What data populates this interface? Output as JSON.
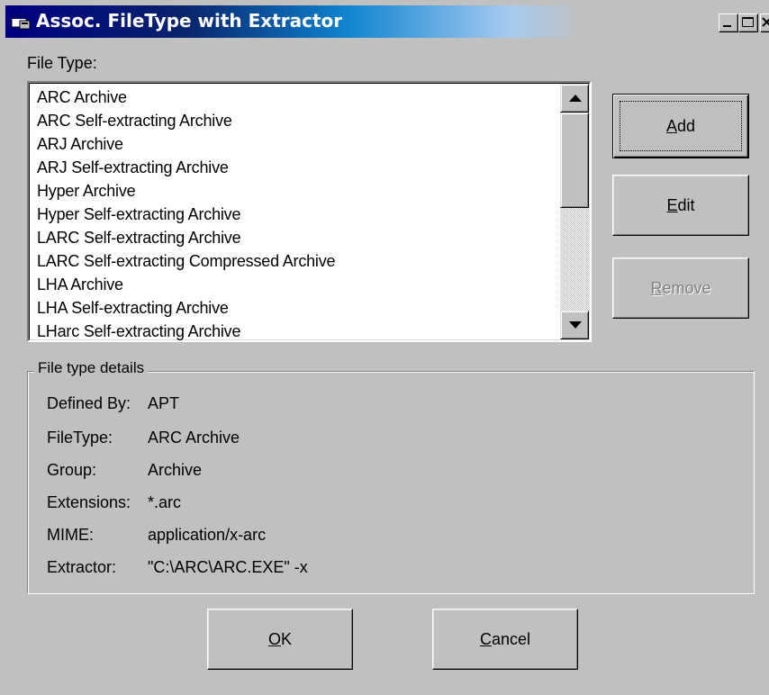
{
  "window": {
    "title": "Assoc. FileType with Extractor",
    "icon": "app-window-icon",
    "controls": [
      "minimize-icon",
      "maximize-icon",
      "close-icon"
    ]
  },
  "file_type_label": "File Type:",
  "file_types": [
    "ARC Archive",
    "ARC Self-extracting Archive",
    "ARJ Archive",
    "ARJ Self-extracting Archive",
    "Hyper Archive",
    "Hyper Self-extracting Archive",
    "LARC Self-extracting Archive",
    "LARC Self-extracting Compressed Archive",
    "LHA Archive",
    "LHA Self-extracting Archive",
    "LHarc Self-extracting Archive"
  ],
  "buttons": {
    "add": {
      "mnemonic": "A",
      "rest": "dd"
    },
    "edit": {
      "mnemonic": "E",
      "rest": "dit"
    },
    "remove": {
      "mnemonic": "R",
      "rest": "emove",
      "disabled": true
    },
    "ok": {
      "mnemonic": "O",
      "rest": "K"
    },
    "cancel": {
      "mnemonic": "C",
      "rest": "ancel"
    }
  },
  "details": {
    "legend": "File type details",
    "defined_by": {
      "label": "Defined By:",
      "value": "APT"
    },
    "file_type": {
      "label": "FileType:",
      "value": "ARC Archive"
    },
    "group": {
      "label": "Group:",
      "value": "Archive"
    },
    "extensions": {
      "label": "Extensions:",
      "value": "*.arc"
    },
    "mime": {
      "label": "MIME:",
      "value": "application/x-arc"
    },
    "extractor": {
      "label": "Extractor:",
      "value": "\"C:\\ARC\\ARC.EXE\" -x"
    }
  },
  "colors": {
    "title_start": "#000080",
    "title_end": "#1084d0",
    "face": "#c0c0c0",
    "disabled_text": "#808080"
  }
}
